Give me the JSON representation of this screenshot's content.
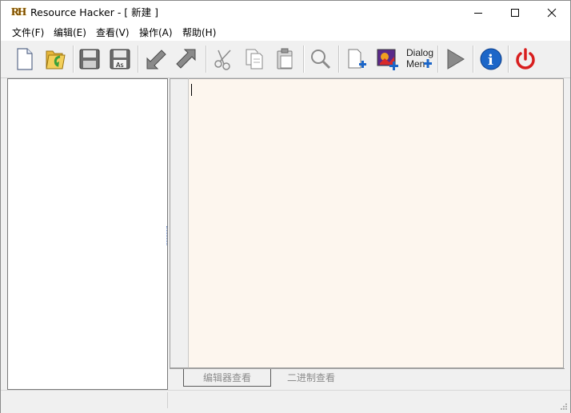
{
  "window": {
    "title": "Resource Hacker - [ 新建 ]",
    "icon_label": "RH",
    "controls": [
      "minimize-icon",
      "maximize-icon",
      "close-icon"
    ]
  },
  "menubar": {
    "items": [
      {
        "label": "文件(F)"
      },
      {
        "label": "编辑(E)"
      },
      {
        "label": "查看(V)"
      },
      {
        "label": "操作(A)"
      },
      {
        "label": "帮助(H)"
      }
    ]
  },
  "toolbar": {
    "buttons": [
      {
        "name": "new-file-icon"
      },
      {
        "name": "open-folder-icon"
      },
      {
        "name": "save-icon"
      },
      {
        "name": "save-as-icon",
        "label": "As"
      },
      {
        "name": "compile-back-icon"
      },
      {
        "name": "compile-forward-icon"
      },
      {
        "name": "cut-icon"
      },
      {
        "name": "copy-icon"
      },
      {
        "name": "paste-icon"
      },
      {
        "name": "search-icon"
      },
      {
        "name": "add-resource-icon"
      },
      {
        "name": "add-image-resource-icon"
      },
      {
        "name": "dialog-menu-icon",
        "label_top": "Dialog",
        "label_bottom": "Men"
      },
      {
        "name": "run-play-icon"
      },
      {
        "name": "info-icon",
        "label": "i"
      },
      {
        "name": "power-exit-icon"
      }
    ],
    "accent": {
      "blue": "#1c66c8",
      "red": "#d81e1e",
      "folder": "#e6b63a",
      "green": "#3aa03a"
    }
  },
  "editor": {
    "content": "",
    "background": "#fdf6ee"
  },
  "tabs": [
    {
      "label": "编辑器查看",
      "active": true
    },
    {
      "label": "二进制查看",
      "active": false
    }
  ],
  "statusbar": {
    "panes": [
      "",
      ""
    ]
  }
}
